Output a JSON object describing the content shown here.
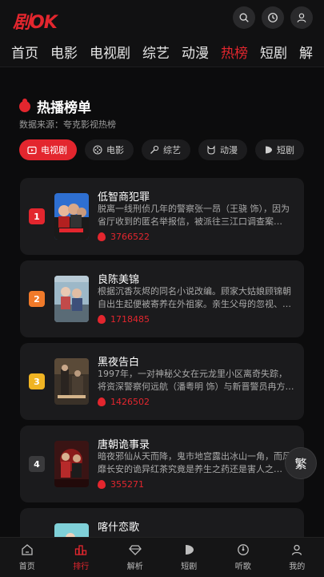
{
  "header": {
    "logo": "剧OK",
    "buttons": [
      "search-icon",
      "history-icon",
      "user-icon"
    ]
  },
  "nav": [
    "首页",
    "电影",
    "电视剧",
    "综艺",
    "动漫",
    "热榜",
    "短剧",
    "解"
  ],
  "nav_active": 5,
  "section": {
    "title": "热播榜单",
    "source": "数据来源：夸克影视热榜"
  },
  "categories": [
    {
      "label": "电视剧",
      "icon": "tv-icon",
      "active": true
    },
    {
      "label": "电影",
      "icon": "film-reel-icon",
      "active": false
    },
    {
      "label": "综艺",
      "icon": "mic-icon",
      "active": false
    },
    {
      "label": "动漫",
      "icon": "cat-icon",
      "active": false
    },
    {
      "label": "短剧",
      "icon": "play-icon",
      "active": false
    }
  ],
  "items": [
    {
      "rank": "1",
      "title": "低智商犯罪",
      "desc": "脱离一线刑侦几年的警察张一昂（王骁 饰），因为省厅收到的匿名举报信，被派往三江口调查案件。...",
      "heat": "3766522",
      "rank_color": "#e3262e"
    },
    {
      "rank": "2",
      "title": "良陈美锦",
      "desc": "根据沉香灰烬的同名小说改编。顾家大姑娘顾锦朝自出生起便被寄养在外祖家。亲生父母的忽视、外...",
      "heat": "1718485",
      "rank_color": "#f07a2a"
    },
    {
      "rank": "3",
      "title": "黑夜告白",
      "desc": "1997年，一对神秘父女在元龙里小区离奇失踪，将资深警察何远航（潘粤明 饰）与新晋警员冉方旭...",
      "heat": "1426502",
      "rank_color": "#f0b423"
    },
    {
      "rank": "4",
      "title": "唐朝诡事录",
      "desc": "暗夜邪仙从天而降，鬼市地宫露出冰山一角，而风靡长安的诡异红茶究竟是养生之药还是害人之物?...",
      "heat": "355271",
      "rank_color": "#3a3a3c"
    },
    {
      "rank": "5",
      "title": "喀什恋歌",
      "desc": "",
      "heat": "",
      "rank_color": "#3a3a3c"
    }
  ],
  "fab": "繁",
  "tabbar": [
    {
      "label": "首页",
      "icon": "home-icon"
    },
    {
      "label": "排行",
      "icon": "ranking-icon",
      "active": true
    },
    {
      "label": "解析",
      "icon": "diamond-icon"
    },
    {
      "label": "短剧",
      "icon": "shorts-icon"
    },
    {
      "label": "听歌",
      "icon": "music-disc-icon"
    },
    {
      "label": "我的",
      "icon": "profile-icon"
    }
  ],
  "colors": {
    "accent": "#e3262e",
    "bg": "#111112",
    "card": "#1b1b1d"
  }
}
